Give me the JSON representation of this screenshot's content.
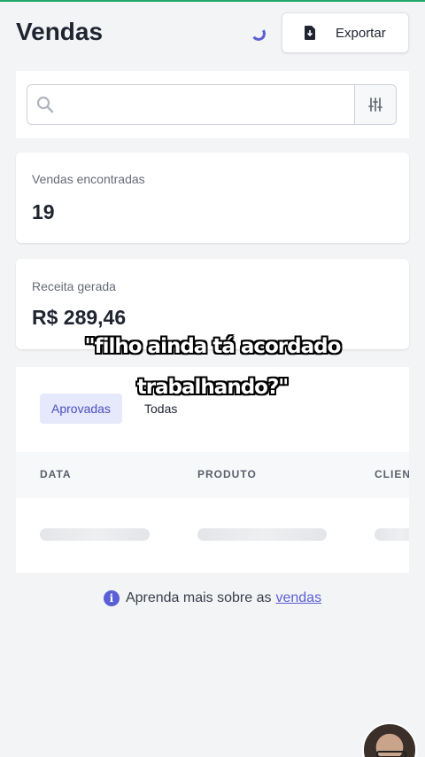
{
  "header": {
    "title": "Vendas",
    "export_label": "Exportar"
  },
  "search": {
    "placeholder": ""
  },
  "stats": {
    "sales_found_label": "Vendas encontradas",
    "sales_found_value": "19",
    "revenue_label": "Receita gerada",
    "revenue_value": "R$ 289,46"
  },
  "tabs": [
    {
      "label": "Aprovadas",
      "active": true
    },
    {
      "label": "Todas",
      "active": false
    }
  ],
  "table": {
    "columns": [
      "DATA",
      "PRODUTO",
      "CLIEN"
    ]
  },
  "help": {
    "text": "Aprenda mais sobre as",
    "link": "vendas"
  },
  "caption": {
    "line1": "\"filho ainda tá acordado",
    "line2": "trabalhando?\""
  },
  "colors": {
    "accent": "#5b5fd6",
    "top_bar": "#1fa86b",
    "background": "#f3f4f6"
  },
  "icons": [
    "loading-spinner",
    "export-file-icon",
    "search-icon",
    "filter-sliders-icon",
    "info-icon"
  ]
}
